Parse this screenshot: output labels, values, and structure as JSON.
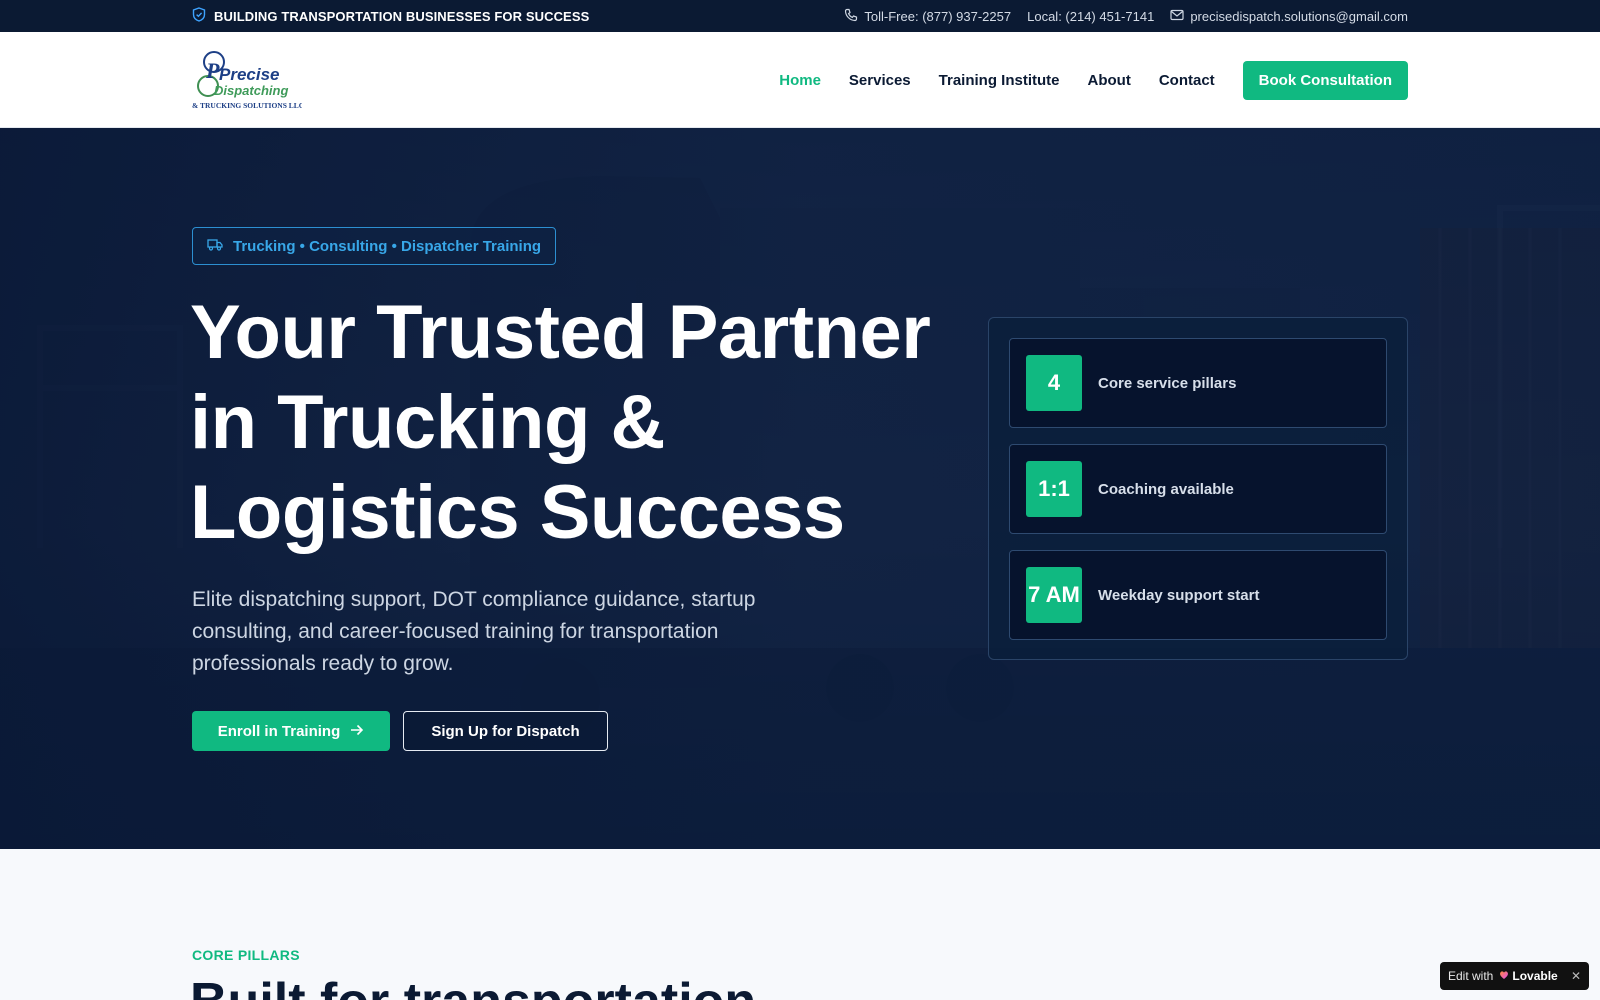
{
  "topbar": {
    "tagline": "BUILDING TRANSPORTATION BUSINESSES FOR SUCCESS",
    "toll_free": "Toll-Free: (877) 937-2257",
    "local": "Local: (214) 451-7141",
    "email": "precisedispatch.solutions@gmail.com"
  },
  "logo": {
    "line1": "Precise",
    "line2": "Dispatching",
    "line3": "& TRUCKING SOLUTIONS LLC"
  },
  "nav": {
    "items": [
      {
        "label": "Home",
        "active": true
      },
      {
        "label": "Services",
        "active": false
      },
      {
        "label": "Training Institute",
        "active": false
      },
      {
        "label": "About",
        "active": false
      },
      {
        "label": "Contact",
        "active": false
      }
    ],
    "cta": "Book Consultation"
  },
  "hero": {
    "pill": "Trucking • Consulting • Dispatcher Training",
    "headline_lines": [
      "Your Trusted Partner",
      "in Trucking &",
      "Logistics Success"
    ],
    "subhead": "Elite dispatching support, DOT compliance guidance, startup consulting, and career-focused training for transportation professionals ready to grow.",
    "primary_cta": "Enroll in Training",
    "secondary_cta": "Sign Up for Dispatch",
    "stats": [
      {
        "value": "4",
        "label": "Core service pillars"
      },
      {
        "value": "1:1",
        "label": "Coaching available"
      },
      {
        "value": "7 AM",
        "label": "Weekday support start"
      }
    ]
  },
  "section": {
    "eyebrow": "CORE PILLARS",
    "title": "Built for transportation"
  },
  "lovable": {
    "prefix": "Edit with",
    "brand": "Lovable",
    "close": "✕"
  },
  "colors": {
    "accent": "#10b981",
    "navy": "#0b1a33",
    "pill_blue": "#38a7e8"
  }
}
